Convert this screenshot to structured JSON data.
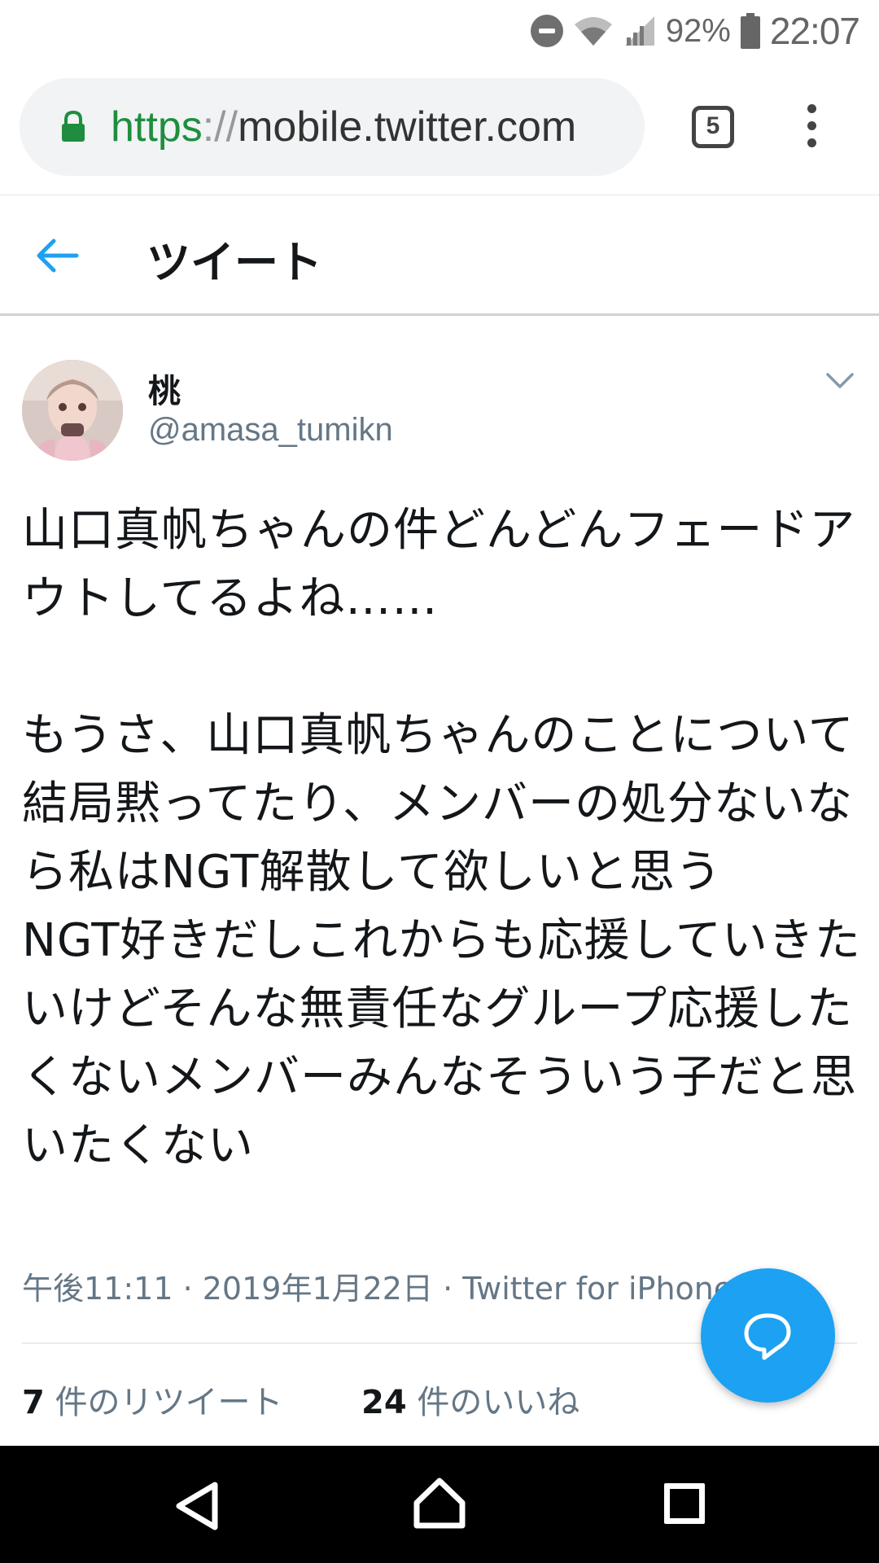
{
  "status_bar": {
    "battery_percent": "92%",
    "clock": "22:07"
  },
  "browser": {
    "url_scheme": "https",
    "url_separator": "://",
    "url_host": "mobile.twitter.com",
    "tab_count": "5"
  },
  "header": {
    "title": "ツイート"
  },
  "tweet": {
    "author_name": "桃",
    "author_handle": "@amasa_tumikn",
    "text": "山口真帆ちゃんの件どんどんフェードアウトしてるよね……\n\nもうさ、山口真帆ちゃんのことについて結局黙ってたり、メンバーの処分ないなら私はNGT解散して欲しいと思う\nNGT好きだしこれからも応援していきたいけどそんな無責任なグループ応援したくないメンバーみんなそういう子だと思いたくない",
    "meta": "午後11:11 · 2019年1月22日 · Twitter for iPhone",
    "retweet_count": "7",
    "retweet_label_prefix": " 件の",
    "retweet_label": "リツイート",
    "like_count": "24",
    "like_label_prefix": " 件の",
    "like_label": "いいね"
  },
  "icons": {
    "lock": "lock-icon",
    "back": "back-arrow-icon",
    "caret": "chevron-down-icon",
    "reply_fab": "reply-icon"
  },
  "colors": {
    "twitter_blue": "#1da1f2",
    "secure_green": "#1e8e3e",
    "secondary_text": "#657786"
  }
}
